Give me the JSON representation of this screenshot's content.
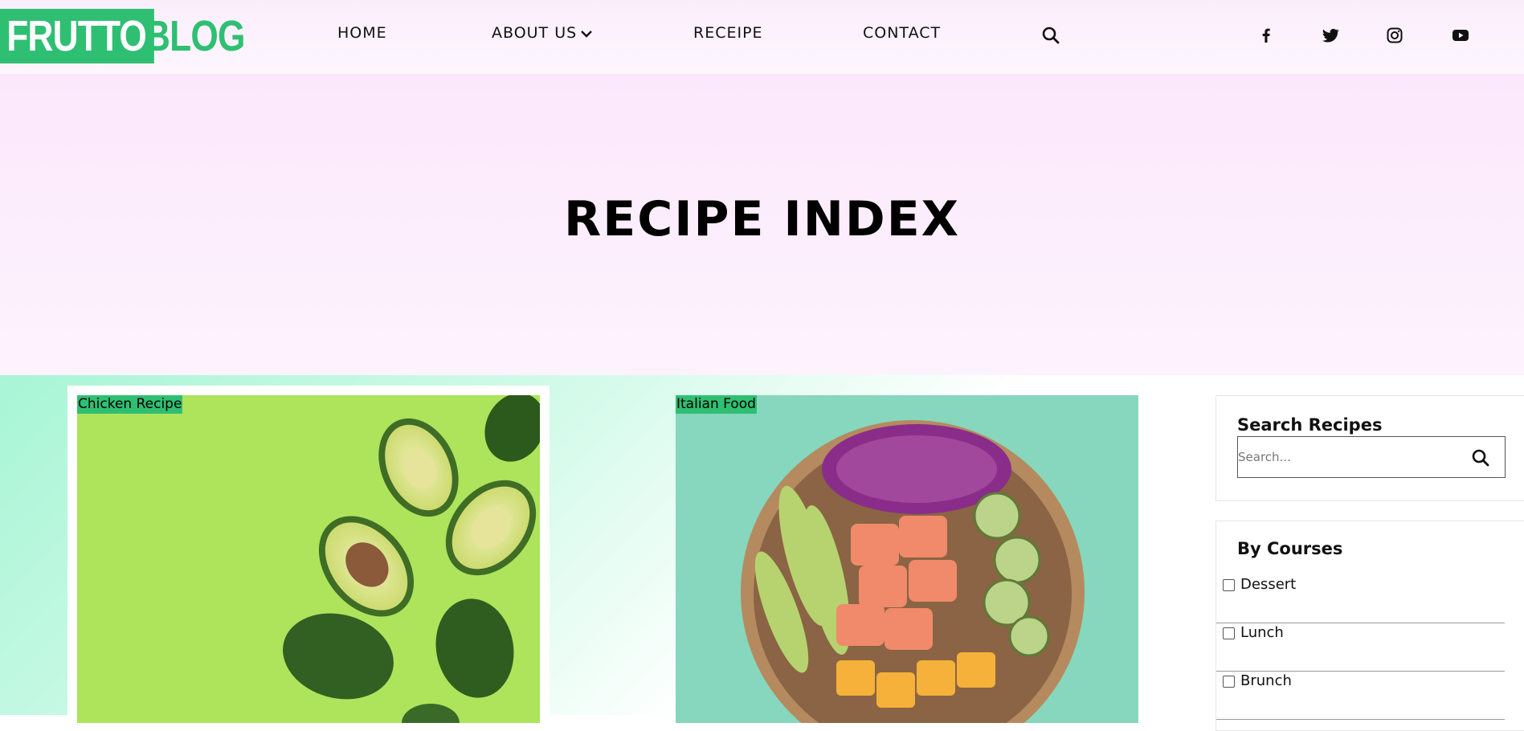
{
  "logo": {
    "part1": "FRUTTO",
    "part2": "BLOG"
  },
  "nav": {
    "home": "HOME",
    "about": "ABOUT US",
    "recipe": "RECEIPE",
    "contact": "CONTACT"
  },
  "social": [
    "facebook-icon",
    "twitter-icon",
    "instagram-icon",
    "youtube-icon"
  ],
  "hero": {
    "title": "RECIPE INDEX"
  },
  "cards": [
    {
      "tag": "Chicken Recipe"
    },
    {
      "tag": "Italian Food"
    }
  ],
  "sidebar": {
    "search_title": "Search Recipes",
    "search_placeholder": "Search...",
    "courses_title": "By Courses",
    "courses": [
      "Dessert",
      "Lunch",
      "Brunch"
    ]
  },
  "colors": {
    "brand": "#2fbf73",
    "hero_bg": "#fce8fc",
    "content_bg": "#a8f5d6"
  }
}
